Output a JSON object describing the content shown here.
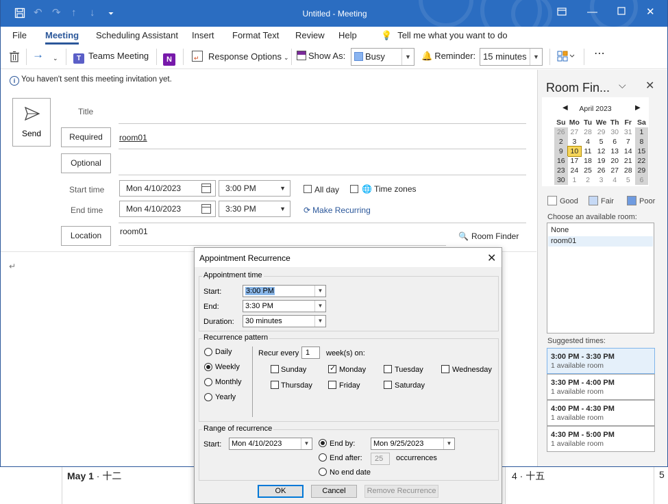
{
  "window": {
    "title": "Untitled",
    "title_sep": " - ",
    "title_kind": "Meeting"
  },
  "ribbon": {
    "tabs": [
      "File",
      "Meeting",
      "Scheduling Assistant",
      "Insert",
      "Format Text",
      "Review",
      "Help"
    ],
    "active_tab": "Meeting",
    "tell_me": "Tell me what you want to do",
    "teams_meeting": "Teams Meeting",
    "response_options": "Response Options",
    "show_as_label": "Show As:",
    "show_as_value": "Busy",
    "reminder_label": "Reminder:",
    "reminder_value": "15 minutes",
    "more": "⋯"
  },
  "info_bar": "You haven't sent this meeting invitation yet.",
  "form": {
    "send": "Send",
    "title_label": "Title",
    "required_label": "Required",
    "required_value": "room01",
    "optional_label": "Optional",
    "start_time_label": "Start time",
    "start_date": "Mon 4/10/2023",
    "start_time": "3:00 PM",
    "end_time_label": "End time",
    "end_date": "Mon 4/10/2023",
    "end_time": "3:30 PM",
    "all_day": "All day",
    "time_zones": "Time zones",
    "make_recurring": "Make Recurring",
    "location_label": "Location",
    "location_value": "room01",
    "room_finder": "Room Finder",
    "body_mark": "↵"
  },
  "room_finder": {
    "title": "Room Fin...",
    "calendar": {
      "month": "April 2023",
      "weekdays": [
        "Su",
        "Mo",
        "Tu",
        "We",
        "Th",
        "Fr",
        "Sa"
      ],
      "weeks": [
        [
          "26",
          "27",
          "28",
          "29",
          "30",
          "31",
          "1"
        ],
        [
          "2",
          "3",
          "4",
          "5",
          "6",
          "7",
          "8"
        ],
        [
          "9",
          "10",
          "11",
          "12",
          "13",
          "14",
          "15"
        ],
        [
          "16",
          "17",
          "18",
          "19",
          "20",
          "21",
          "22"
        ],
        [
          "23",
          "24",
          "25",
          "26",
          "27",
          "28",
          "29"
        ],
        [
          "30",
          "1",
          "2",
          "3",
          "4",
          "5",
          "6"
        ]
      ],
      "today": "10"
    },
    "legend": {
      "good": "Good",
      "fair": "Fair",
      "poor": "Poor",
      "good_color": "#ffffff",
      "fair_color": "#c6d9f5",
      "poor_color": "#6f9be0"
    },
    "choose_label": "Choose an available room:",
    "rooms": [
      "None",
      "room01"
    ],
    "suggested_label": "Suggested times:",
    "suggestions": [
      {
        "time": "3:00 PM - 3:30 PM",
        "avail": "1 available room"
      },
      {
        "time": "3:30 PM - 4:00 PM",
        "avail": "1 available room"
      },
      {
        "time": "4:00 PM - 4:30 PM",
        "avail": "1 available room"
      },
      {
        "time": "4:30 PM - 5:00 PM",
        "avail": "1 available room"
      }
    ]
  },
  "dialog": {
    "title": "Appointment Recurrence",
    "appointment_time": {
      "group": "Appointment time",
      "start_label": "Start:",
      "start_value": "3:00 PM",
      "end_label": "End:",
      "end_value": "3:30 PM",
      "duration_label": "Duration:",
      "duration_value": "30 minutes"
    },
    "pattern": {
      "group": "Recurrence pattern",
      "options": [
        "Daily",
        "Weekly",
        "Monthly",
        "Yearly"
      ],
      "selected": "Weekly",
      "recur_every": "Recur every",
      "recur_value": "1",
      "weeks_on": "week(s) on:",
      "days": [
        "Sunday",
        "Monday",
        "Tuesday",
        "Wednesday",
        "Thursday",
        "Friday",
        "Saturday"
      ],
      "checked": [
        "Monday"
      ]
    },
    "range": {
      "group": "Range of recurrence",
      "start_label": "Start:",
      "start_value": "Mon 4/10/2023",
      "end_by_label": "End by:",
      "end_by_value": "Mon 9/25/2023",
      "end_after_label": "End after:",
      "end_after_value": "25",
      "occurrences": "occurrences",
      "no_end": "No end date"
    },
    "ok": "OK",
    "cancel": "Cancel",
    "remove": "Remove Recurrence"
  },
  "background_calendar": {
    "day1_num": "May 1",
    "day1_rest": " · 十二",
    "day2": "4 · 十五",
    "day3": "5"
  }
}
